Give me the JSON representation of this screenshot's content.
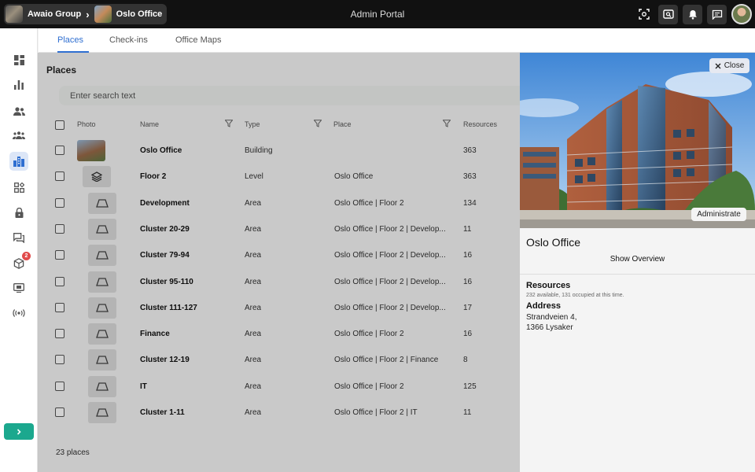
{
  "app_title": "Admin Portal",
  "breadcrumb": {
    "org": "Awaio Group",
    "site": "Oslo Office"
  },
  "tabs": [
    "Places",
    "Check-ins",
    "Office Maps"
  ],
  "places": {
    "title": "Places",
    "search_placeholder": "Enter search text",
    "columns": {
      "photo": "Photo",
      "name": "Name",
      "type": "Type",
      "place": "Place",
      "resources": "Resources"
    },
    "rows": [
      {
        "name": "Oslo Office",
        "type": "Building",
        "place": "",
        "resources": "363",
        "icon": "photo"
      },
      {
        "name": "Floor 2",
        "type": "Level",
        "place": "Oslo Office",
        "resources": "363",
        "icon": "layers-icon"
      },
      {
        "name": "Development",
        "type": "Area",
        "place": "Oslo Office | Floor 2",
        "resources": "134",
        "icon": "area-icon"
      },
      {
        "name": "Cluster 20-29",
        "type": "Area",
        "place": "Oslo Office | Floor 2 | Develop...",
        "resources": "11",
        "icon": "area-icon"
      },
      {
        "name": "Cluster 79-94",
        "type": "Area",
        "place": "Oslo Office | Floor 2 | Develop...",
        "resources": "16",
        "icon": "area-icon"
      },
      {
        "name": "Cluster 95-110",
        "type": "Area",
        "place": "Oslo Office | Floor 2 | Develop...",
        "resources": "16",
        "icon": "area-icon"
      },
      {
        "name": "Cluster 111-127",
        "type": "Area",
        "place": "Oslo Office | Floor 2 | Develop...",
        "resources": "17",
        "icon": "area-icon"
      },
      {
        "name": "Finance",
        "type": "Area",
        "place": "Oslo Office | Floor 2",
        "resources": "16",
        "icon": "area-icon"
      },
      {
        "name": "Cluster 12-19",
        "type": "Area",
        "place": "Oslo Office | Floor 2 | Finance",
        "resources": "8",
        "icon": "area-icon"
      },
      {
        "name": "IT",
        "type": "Area",
        "place": "Oslo Office | Floor 2",
        "resources": "125",
        "icon": "area-icon"
      },
      {
        "name": "Cluster 1-11",
        "type": "Area",
        "place": "Oslo Office | Floor 2 | IT",
        "resources": "11",
        "icon": "area-icon"
      }
    ],
    "count": "23 places"
  },
  "sidebar": {
    "badge": "2"
  },
  "detail": {
    "close": "Close",
    "administrate": "Administrate",
    "title": "Oslo Office",
    "show_overview": "Show Overview",
    "resources_heading": "Resources",
    "resources_text": "232 available, 131 occupied at this time.",
    "address_heading": "Address",
    "address_line1": "Strandveien 4,",
    "address_line2": "1366 Lysaker"
  },
  "colors": {
    "accent": "#2f6fd1",
    "expand": "#1ba88e",
    "badge": "#e14b4b"
  }
}
